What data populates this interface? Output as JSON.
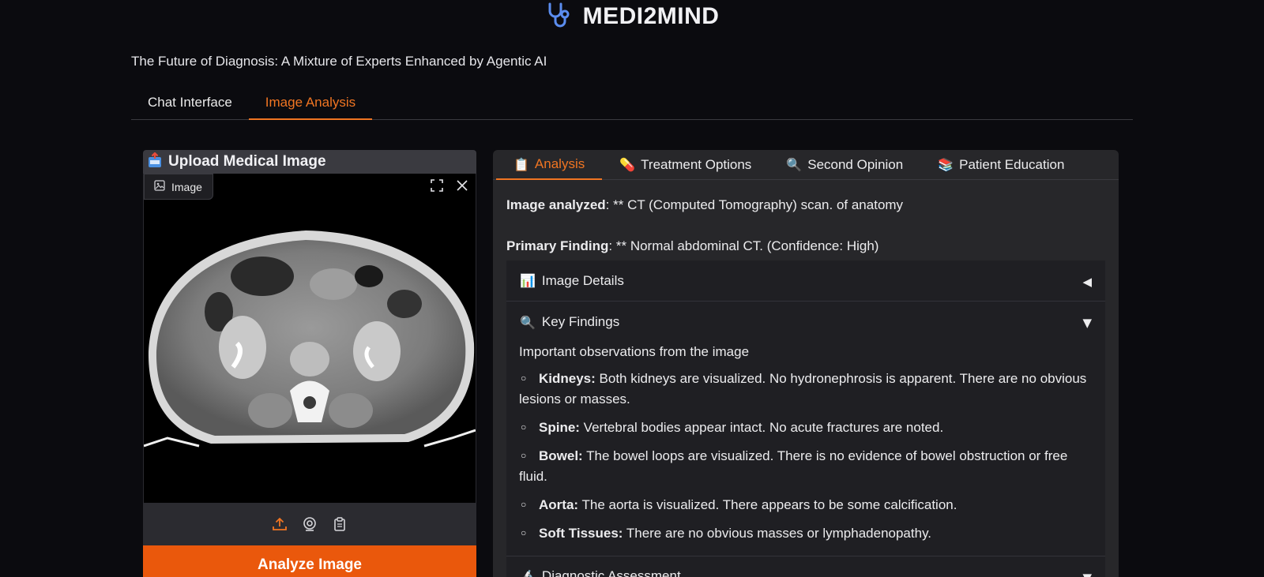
{
  "app": {
    "title": "MEDI2MIND",
    "subtitle": "The Future of Diagnosis: A Mixture of Experts Enhanced by Agentic AI",
    "logo_icon": "stethoscope-icon"
  },
  "main_tabs": [
    {
      "label": "Chat Interface",
      "active": false
    },
    {
      "label": "Image Analysis",
      "active": true
    }
  ],
  "upload": {
    "title": "Upload Medical Image",
    "image_label": "Image",
    "analyze_label": "Analyze Image",
    "image_description": "axial abdominal CT slice"
  },
  "result_tabs": [
    {
      "label": "Analysis",
      "icon": "📋",
      "active": true
    },
    {
      "label": "Treatment Options",
      "icon": "💊",
      "active": false
    },
    {
      "label": "Second Opinion",
      "icon": "🔍",
      "active": false
    },
    {
      "label": "Patient Education",
      "icon": "📚",
      "active": false
    }
  ],
  "analysis": {
    "image_analyzed_label": "Image analyzed",
    "image_analyzed_value": ": ** CT (Computed Tomography) scan. of anatomy",
    "primary_finding_label": "Primary Finding",
    "primary_finding_value": ": ** Normal abdominal CT. (Confidence: High)"
  },
  "sections": {
    "image_details": {
      "icon": "📊",
      "label": "Image Details",
      "toggle": "◀"
    },
    "key_findings": {
      "icon": "🔍",
      "label": "Key Findings",
      "toggle": "▼",
      "intro": "Important observations from the image",
      "items": [
        {
          "term": "Kidneys:",
          "text": " Both kidneys are visualized. No hydronephrosis is apparent. There are no obvious lesions or masses."
        },
        {
          "term": "Spine:",
          "text": " Vertebral bodies appear intact. No acute fractures are noted."
        },
        {
          "term": "Bowel:",
          "text": " The bowel loops are visualized. There is no evidence of bowel obstruction or free fluid."
        },
        {
          "term": "Aorta:",
          "text": " The aorta is visualized. There appears to be some calcification."
        },
        {
          "term": "Soft Tissues:",
          "text": " There are no obvious masses or lymphadenopathy."
        }
      ]
    },
    "diagnostic_assessment": {
      "icon": "🔬",
      "label": "Diagnostic Assessment",
      "toggle": "▼"
    }
  },
  "colors": {
    "accent": "#f07522",
    "button": "#ea580c",
    "panel": "#27272a",
    "background": "#0b0b0f"
  }
}
